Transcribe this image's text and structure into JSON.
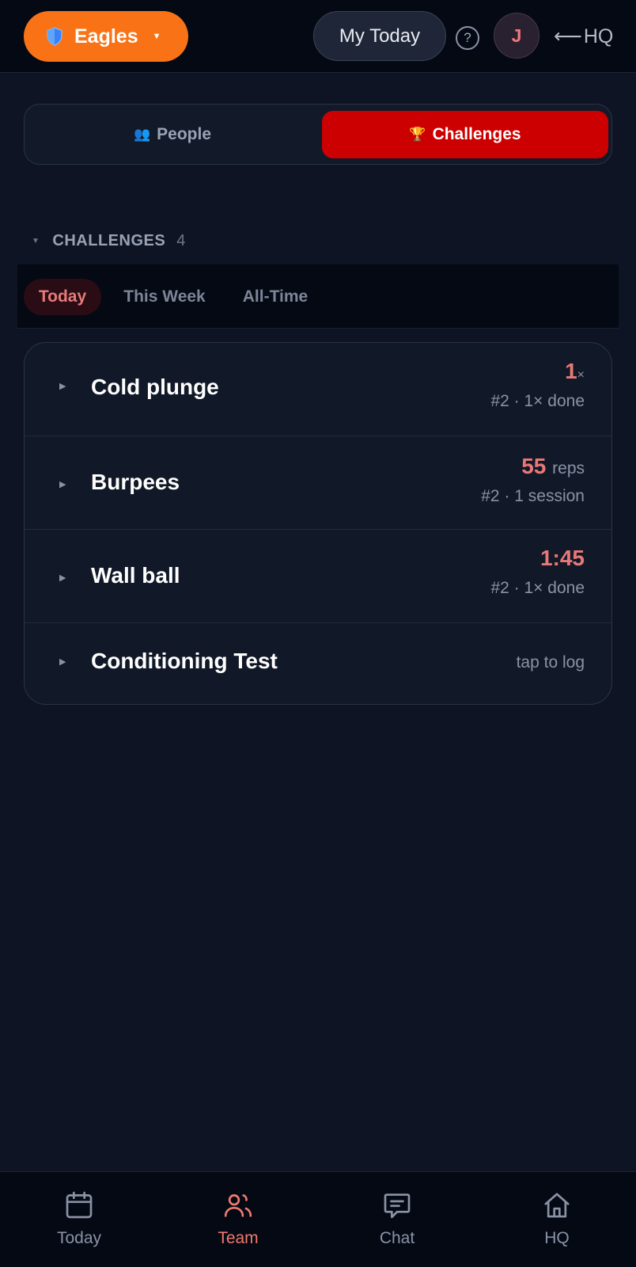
{
  "header": {
    "team_name": "Eagles",
    "team_icon": "shield-icon",
    "my_today_label": "My Today",
    "help_label": "?",
    "avatar_initial": "J",
    "hq_arrow": "⟵",
    "hq_label": "HQ",
    "accent_color": "#f97316"
  },
  "segmented": {
    "people_icon": "👥",
    "people_label": "People",
    "challenges_icon": "🏆",
    "challenges_label": "Challenges",
    "active": "Challenges",
    "active_color": "#cc0000"
  },
  "section": {
    "title": "CHALLENGES",
    "count": "4"
  },
  "range_tabs": [
    {
      "label": "Today",
      "active": true
    },
    {
      "label": "This Week",
      "active": false
    },
    {
      "label": "All-Time",
      "active": false
    }
  ],
  "challenges": [
    {
      "name": "Cold plunge",
      "value": "1",
      "unit": "×",
      "meta": "#2 · 1× done"
    },
    {
      "name": "Burpees",
      "value": "55",
      "unit": "reps",
      "meta": "#2 · 1 session"
    },
    {
      "name": "Wall ball",
      "value": "1:45",
      "unit": "",
      "meta": "#2 · 1× done"
    },
    {
      "name": "Conditioning Test",
      "value": "",
      "unit": "",
      "meta": "tap to log"
    }
  ],
  "bottom_nav": [
    {
      "label": "Today",
      "icon": "calendar-icon",
      "active": false
    },
    {
      "label": "Team",
      "icon": "team-icon",
      "active": true
    },
    {
      "label": "Chat",
      "icon": "chat-icon",
      "active": false
    },
    {
      "label": "HQ",
      "icon": "home-icon",
      "active": false
    }
  ]
}
